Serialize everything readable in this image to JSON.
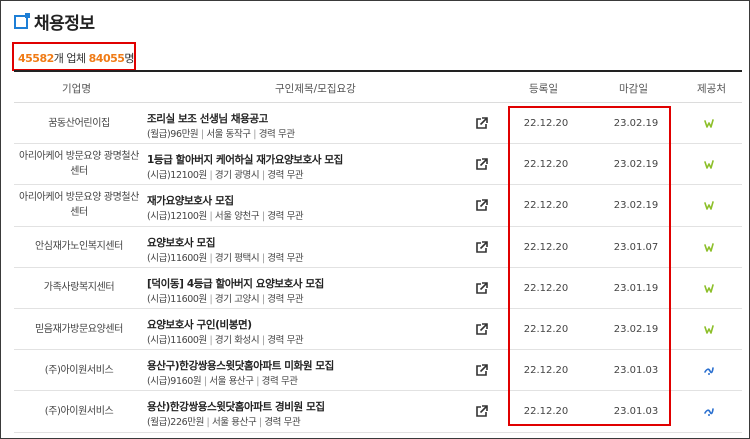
{
  "header": {
    "title": "채용정보"
  },
  "summary": {
    "company_count": "45582",
    "company_unit": "개 업체",
    "people_count": "84055",
    "people_unit": "명"
  },
  "table": {
    "headers": {
      "company": "기업명",
      "job": "구인제목/모집요강",
      "reg": "등록일",
      "deadline": "마감일",
      "provider": "제공처"
    },
    "rows": [
      {
        "company": "꿈동산어린이집",
        "title": "조리실 보조 선생님 채용공고",
        "pay_type": "(월급)",
        "pay": "96만원",
        "region": "서울 동작구",
        "career": "경력 무관",
        "reg": "22.12.20",
        "deadline": "23.02.19",
        "provider": "worknet",
        "provider_color": "#8dbf2a"
      },
      {
        "company": "아리아케어 방문요양 광명철산센터",
        "title": "1등급 할아버지 케어하실 재가요양보호사 모집",
        "pay_type": "(시급)",
        "pay": "12100원",
        "region": "경기 광명시",
        "career": "경력 무관",
        "reg": "22.12.20",
        "deadline": "23.02.19",
        "provider": "worknet",
        "provider_color": "#8dbf2a"
      },
      {
        "company": "아리아케어 방문요양 광명철산센터",
        "title": "재가요양보호사 모집",
        "pay_type": "(시급)",
        "pay": "12100원",
        "region": "서울 양천구",
        "career": "경력 무관",
        "reg": "22.12.20",
        "deadline": "23.02.19",
        "provider": "worknet",
        "provider_color": "#8dbf2a"
      },
      {
        "company": "안심재가노인복지센터",
        "title": "요양보호사 모집",
        "pay_type": "(시급)",
        "pay": "11600원",
        "region": "경기 평택시",
        "career": "경력 무관",
        "reg": "22.12.20",
        "deadline": "23.01.07",
        "provider": "worknet",
        "provider_color": "#8dbf2a"
      },
      {
        "company": "가족사랑복지센터",
        "title": "[덕이동] 4등급 할아버지 요양보호사 모집",
        "pay_type": "(시급)",
        "pay": "11600원",
        "region": "경기 고양시",
        "career": "경력 무관",
        "reg": "22.12.20",
        "deadline": "23.01.19",
        "provider": "worknet",
        "provider_color": "#8dbf2a"
      },
      {
        "company": "믿음재가방문요양센터",
        "title": "요양보호사 구인(비봉면)",
        "pay_type": "(시급)",
        "pay": "11600원",
        "region": "경기 화성시",
        "career": "경력 무관",
        "reg": "22.12.20",
        "deadline": "23.02.19",
        "provider": "worknet",
        "provider_color": "#8dbf2a"
      },
      {
        "company": "(주)아이원서비스",
        "title": "용산구)한강쌍용스윗닷홈아파트 미화원 모집",
        "pay_type": "(시급)",
        "pay": "9160원",
        "region": "서울 용산구",
        "career": "경력 무관",
        "reg": "22.12.20",
        "deadline": "23.01.03",
        "provider": "senuri",
        "provider_color": "#2a6fcf"
      },
      {
        "company": "(주)아이원서비스",
        "title": "용산)한강쌍용스윗닷홈아파트 경비원 모집",
        "pay_type": "(월급)",
        "pay": "226만원",
        "region": "서울 용산구",
        "career": "경력 무관",
        "reg": "22.12.20",
        "deadline": "23.01.03",
        "provider": "senuri",
        "provider_color": "#2a6fcf"
      }
    ]
  },
  "icons": {
    "title": "square-corner-icon",
    "external_link": "external-link-icon",
    "provider_worknet": "worknet-w-icon",
    "provider_senuri": "senuri-icon"
  },
  "colors": {
    "accent_blue": "#1e7fd6",
    "count_orange": "#f07b16",
    "highlight_red": "#e00000"
  }
}
